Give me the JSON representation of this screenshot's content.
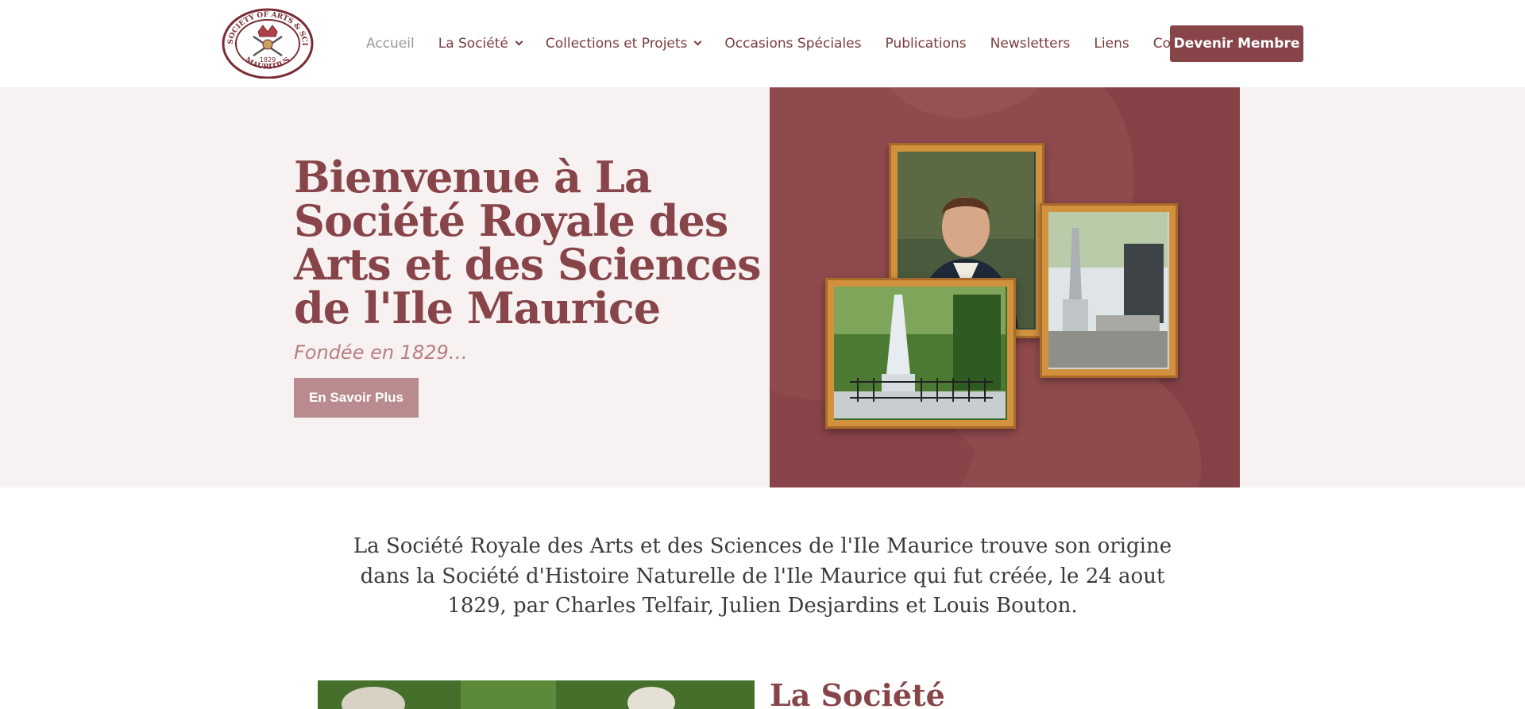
{
  "header": {
    "logo_text": [
      "ROYAL SOCIETY OF ARTS & SCIENCES",
      "MAURITIUS",
      "1829"
    ],
    "nav": [
      {
        "label": "Accueil",
        "active": true,
        "dropdown": false
      },
      {
        "label": "La Société",
        "active": false,
        "dropdown": true
      },
      {
        "label": "Collections et Projets",
        "active": false,
        "dropdown": true
      },
      {
        "label": "Occasions Spéciales",
        "active": false,
        "dropdown": false
      },
      {
        "label": "Publications",
        "active": false,
        "dropdown": false
      },
      {
        "label": "Newsletters",
        "active": false,
        "dropdown": false
      },
      {
        "label": "Liens",
        "active": false,
        "dropdown": false
      },
      {
        "label": "Contact",
        "active": false,
        "dropdown": false
      }
    ],
    "cta_label": "Devenir Membre"
  },
  "hero": {
    "title": "Bienvenue à La Société Royale des Arts et des Sciences de l'Ile Maurice",
    "subtitle": "Fondée en 1829…",
    "button_label": "En Savoir Plus"
  },
  "intro": {
    "text": "La Société Royale des Arts et des Sciences de l'Ile Maurice trouve son origine dans la Société d'Histoire Naturelle de l'Ile Maurice qui fut créée, le 24 aout 1829, par Charles Telfair, Julien Desjardins et Louis Bouton."
  },
  "section": {
    "title": "La Société"
  },
  "colors": {
    "brand": "#874549",
    "nav_text": "#7a3c3f",
    "nav_active": "#9a9a9a",
    "hero_bg": "#f7f1f1",
    "hero_button": "#b98b8e",
    "frame_gold": "#d2913d"
  }
}
